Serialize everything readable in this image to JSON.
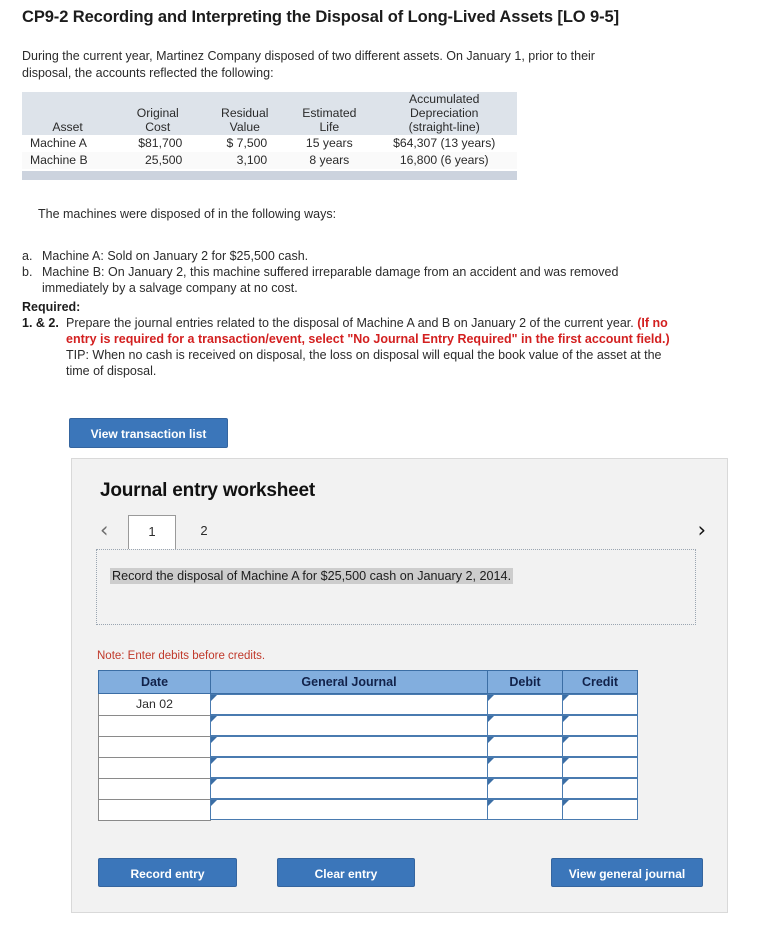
{
  "title": "CP9-2 Recording and Interpreting the Disposal of Long-Lived Assets [LO 9-5]",
  "intro": "During the current year, Martinez Company disposed of two different assets. On January 1, prior to their disposal, the accounts reflected the following:",
  "asset_table": {
    "headers": {
      "asset": "Asset",
      "original_cost_l1": "Original",
      "original_cost_l2": "Cost",
      "residual_value_l1": "Residual",
      "residual_value_l2": "Value",
      "estimated_life_l1": "Estimated",
      "estimated_life_l2": "Life",
      "accum_dep_l1": "Accumulated",
      "accum_dep_l2": "Depreciation",
      "accum_dep_l3": "(straight-line)"
    },
    "rows": [
      {
        "asset": "Machine A",
        "original_cost": "$81,700",
        "residual_value": "$ 7,500",
        "estimated_life": "15 years",
        "accumulated_depreciation": "$64,307 (13 years)"
      },
      {
        "asset": "Machine B",
        "original_cost": "25,500",
        "residual_value": "3,100",
        "estimated_life": "8 years",
        "accumulated_depreciation": "16,800 (6 years)"
      }
    ]
  },
  "disposal": {
    "lead": "The machines were disposed of in the following ways:",
    "items": [
      {
        "marker": "a.",
        "text": "Machine A: Sold on January 2 for $25,500 cash."
      },
      {
        "marker": "b.",
        "text": "Machine B: On January 2, this machine suffered irreparable damage from an accident and was removed immediately by a salvage company at no cost."
      }
    ]
  },
  "required": {
    "heading": "Required:",
    "number": "1. & 2.",
    "text_part1": "Prepare the journal entries related to the disposal of Machine A and B on January 2 of the current year. ",
    "text_red": "(If no entry is required for a transaction/event, select \"No Journal Entry Required\" in the first account field.)",
    "tip": "TIP: When no cash is received on disposal, the loss on disposal will equal the book value of the asset at the time of disposal."
  },
  "buttons": {
    "view_transaction_list": "View transaction list",
    "record_entry": "Record entry",
    "clear_entry": "Clear entry",
    "view_general_journal": "View general journal"
  },
  "worksheet": {
    "panel_title": "Journal entry worksheet",
    "nav_prev_icon": "chevron-left-icon",
    "nav_next_icon": "chevron-right-icon",
    "nav_prev_glyph": "‹",
    "nav_next_glyph": "›",
    "tabs": [
      {
        "label": "1",
        "active": true
      },
      {
        "label": "2",
        "active": false
      }
    ],
    "prompt": "Record the disposal of Machine A for $25,500 cash on January 2, 2014.",
    "note": "Note: Enter debits before credits.",
    "journal_table": {
      "headers": [
        "Date",
        "General Journal",
        "Debit",
        "Credit"
      ],
      "rows": [
        {
          "date": "Jan 02",
          "general_journal": "",
          "debit": "",
          "credit": ""
        },
        {
          "date": "",
          "general_journal": "",
          "debit": "",
          "credit": ""
        },
        {
          "date": "",
          "general_journal": "",
          "debit": "",
          "credit": ""
        },
        {
          "date": "",
          "general_journal": "",
          "debit": "",
          "credit": ""
        },
        {
          "date": "",
          "general_journal": "",
          "debit": "",
          "credit": ""
        },
        {
          "date": "",
          "general_journal": "",
          "debit": "",
          "credit": ""
        }
      ]
    }
  },
  "colors": {
    "button_blue": "#3b76ba",
    "table_header_blue": "#82aede",
    "panel_gray": "#f2f2f2",
    "alert_red": "#d32020",
    "note_red": "#c0392b",
    "data_header_blue_gray": "#dde3ea"
  }
}
